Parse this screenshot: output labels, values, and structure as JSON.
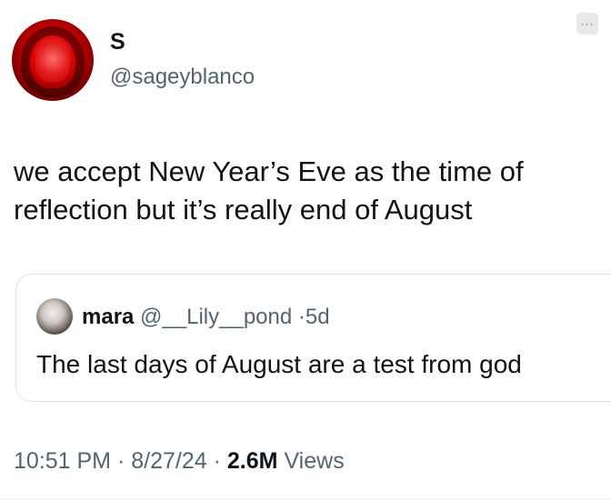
{
  "author": {
    "display_name": "S",
    "handle": "@sageyblanco"
  },
  "more_icon": "···",
  "tweet": {
    "lines": [
      "we accept New Year’s Eve as the time of",
      "reflection but it’s really end of August"
    ]
  },
  "quoted_tweet": {
    "author_name": "mara",
    "author_handle": "@__Lily__pond",
    "separator": "·",
    "age": "5d",
    "text": "The last days of August are a test from god"
  },
  "meta": {
    "time": "10:51 PM",
    "separator": "·",
    "date": "8/27/24",
    "views_count": "2.6M",
    "views_label": "Views"
  }
}
